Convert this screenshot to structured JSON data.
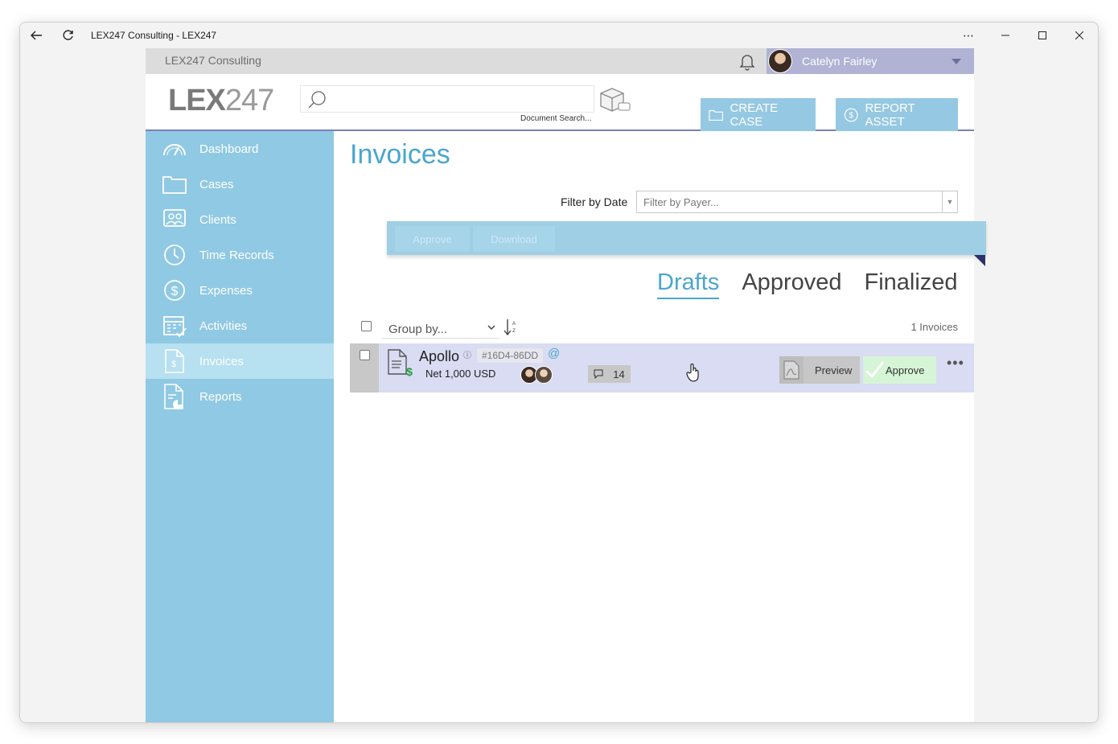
{
  "window": {
    "title": "LEX247 Consulting - LEX247"
  },
  "topbar": {
    "org": "LEX247 Consulting",
    "user_name": "Catelyn Fairley"
  },
  "header": {
    "logo_bold": "LEX",
    "logo_light": "247",
    "search_placeholder": "",
    "search_hint": "Document Search...",
    "create_case": "CREATE CASE",
    "report_asset": "REPORT ASSET"
  },
  "sidebar": {
    "items": [
      {
        "label": "Dashboard",
        "icon": "gauge-icon"
      },
      {
        "label": "Cases",
        "icon": "folder-icon"
      },
      {
        "label": "Clients",
        "icon": "contacts-icon"
      },
      {
        "label": "Time Records",
        "icon": "clock-icon"
      },
      {
        "label": "Expenses",
        "icon": "dollar-icon"
      },
      {
        "label": "Activities",
        "icon": "calendar-icon"
      },
      {
        "label": "Invoices",
        "icon": "invoice-icon",
        "active": true
      },
      {
        "label": "Reports",
        "icon": "report-icon"
      }
    ]
  },
  "main": {
    "title": "Invoices",
    "filter_label": "Filter by Date",
    "filter_placeholder": "Filter by Payer...",
    "actions": {
      "approve": "Approve",
      "download": "Download"
    },
    "tabs": [
      "Drafts",
      "Approved",
      "Finalized"
    ],
    "active_tab": "Drafts",
    "group_by": "Group by...",
    "count": "1 Invoices"
  },
  "invoice": {
    "name": "Apollo",
    "id": "#16D4-86DD",
    "at": "@",
    "net": "Net 1,000 USD",
    "comments": "14",
    "preview": "Preview",
    "approve": "Approve"
  },
  "colors": {
    "accent": "#4aa6cf",
    "sidebar": "#90c9e3",
    "user_bar": "#b0b3d4",
    "row": "#d9dcf2"
  }
}
